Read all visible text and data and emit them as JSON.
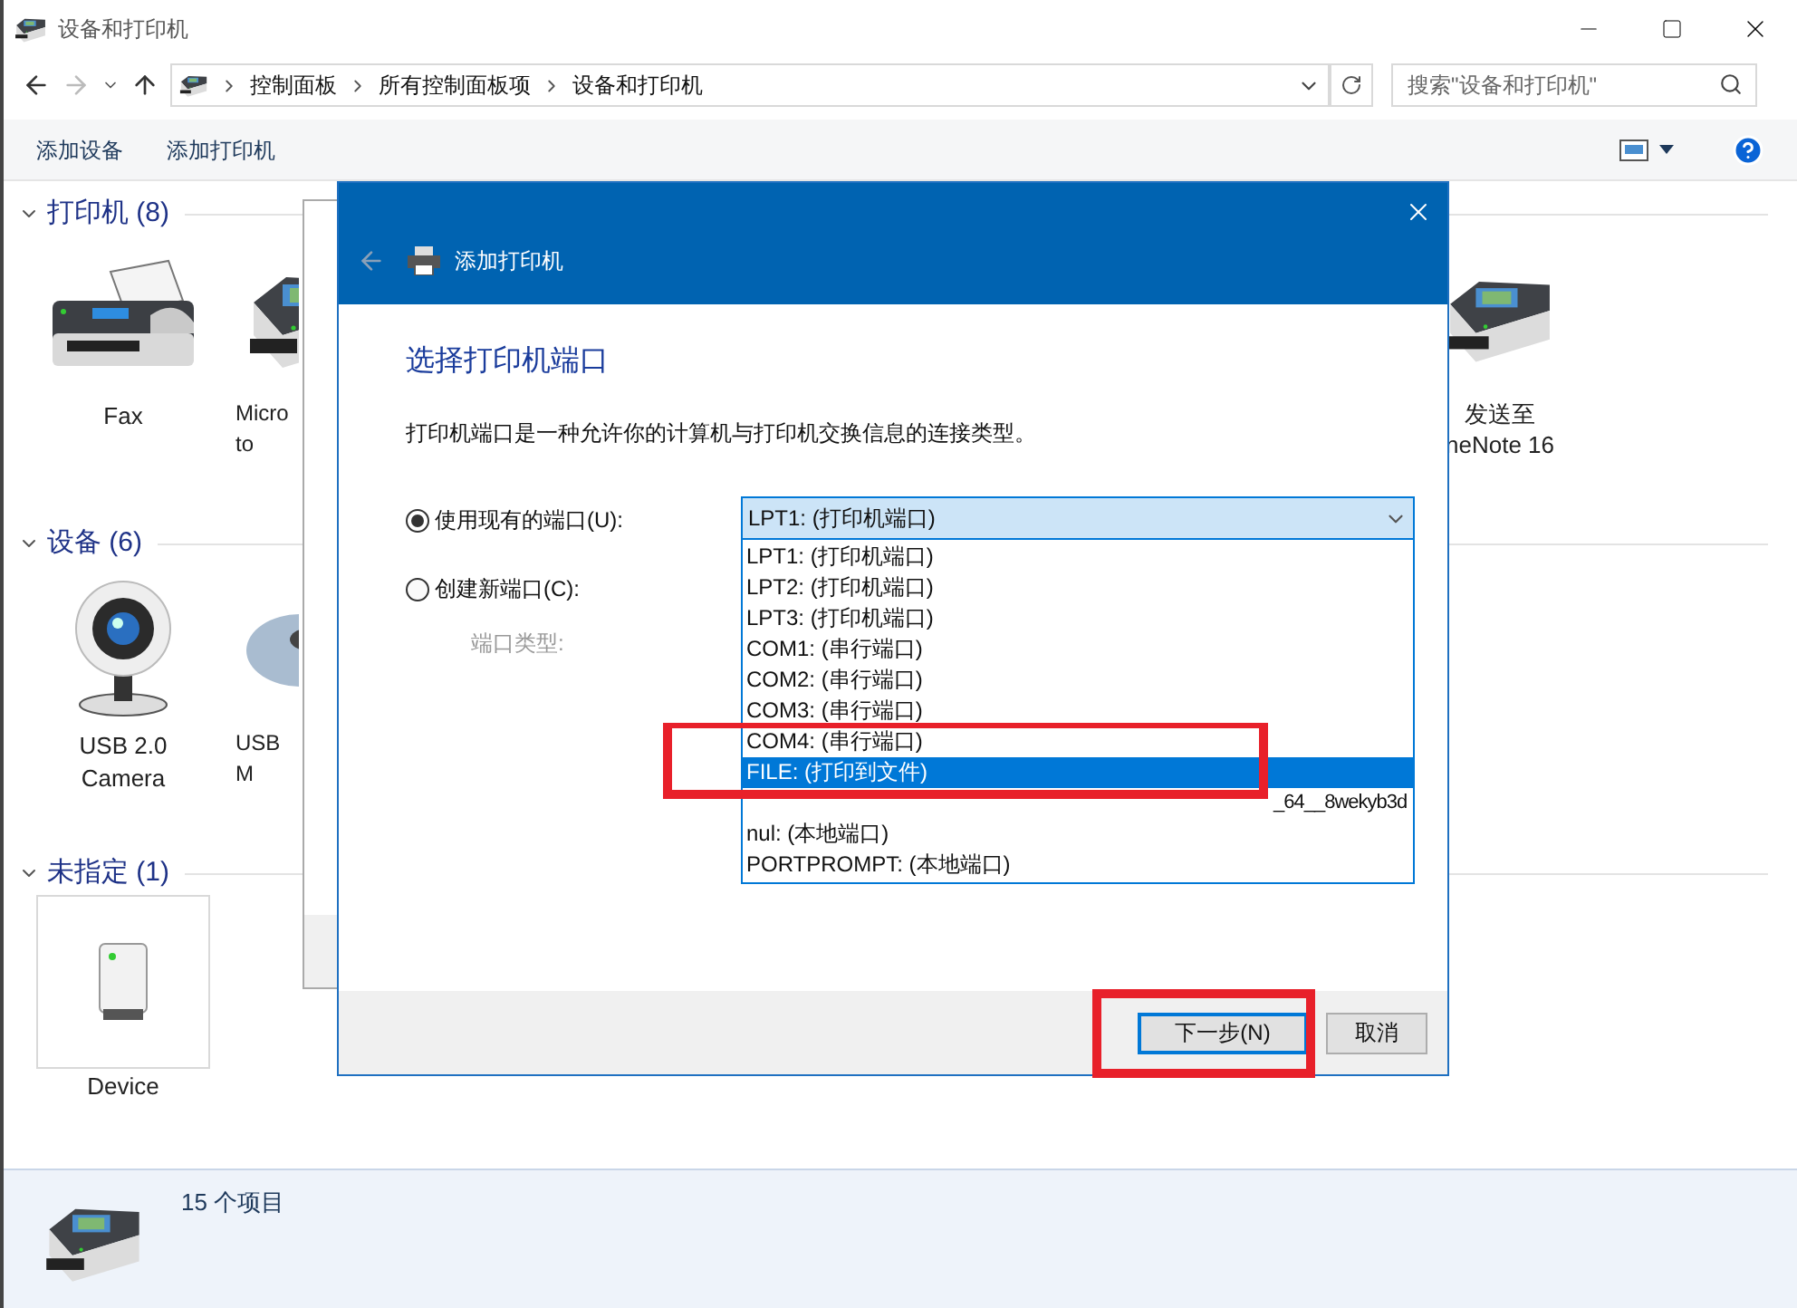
{
  "window": {
    "title": "设备和打印机"
  },
  "address": {
    "breadcrumbs": [
      "控制面板",
      "所有控制面板项",
      "设备和打印机"
    ]
  },
  "search": {
    "placeholder": "搜索\"设备和打印机\""
  },
  "toolbar": [
    "添加设备",
    "添加打印机"
  ],
  "groups": [
    {
      "title": "打印机 (8)",
      "items": [
        {
          "kind": "fax",
          "lines": [
            "Fax"
          ],
          "cut": false
        },
        {
          "kind": "printer",
          "lines": [
            "Micro",
            "to"
          ],
          "cut": true
        }
      ],
      "trailing_item": {
        "kind": "printer",
        "lines": [
          "发送至",
          "neNote 16"
        ]
      }
    },
    {
      "title": "设备 (6)",
      "items": [
        {
          "kind": "webcam",
          "lines": [
            "USB 2.0",
            "Camera"
          ],
          "cut": false
        },
        {
          "kind": "mouse",
          "lines": [
            "USB",
            "M"
          ],
          "cut": true
        }
      ]
    },
    {
      "title": "未指定 (1)",
      "items": [
        {
          "kind": "device",
          "lines": [
            "Device"
          ],
          "cut": false
        }
      ]
    }
  ],
  "status_bar": {
    "count": "15 个项目"
  },
  "dialog": {
    "title": "添加打印机",
    "heading": "选择打印机端口",
    "description": "打印机端口是一种允许你的计算机与打印机交换信息的连接类型。",
    "options": [
      {
        "label": "使用现有的端口(U):",
        "selected": true
      },
      {
        "label": "创建新端口(C):",
        "selected": false
      }
    ],
    "port_type_label": "端口类型:",
    "port_select": {
      "value": "LPT1: (打印机端口)"
    },
    "port_list": [
      {
        "kind": "text",
        "label": "LPT1: (打印机端口)",
        "selected": false
      },
      {
        "kind": "text",
        "label": "LPT2: (打印机端口)",
        "selected": false
      },
      {
        "kind": "text",
        "label": "LPT3: (打印机端口)",
        "selected": false
      },
      {
        "kind": "text",
        "label": "COM1: (串行端口)",
        "selected": false
      },
      {
        "kind": "text",
        "label": "COM2: (串行端口)",
        "selected": false
      },
      {
        "kind": "text",
        "label": "COM3: (串行端口)",
        "selected": false
      },
      {
        "kind": "text",
        "label": "COM4: (串行端口)",
        "selected": false
      },
      {
        "kind": "text",
        "label": "FILE: (打印到文件)",
        "selected": true
      },
      {
        "kind": "obscured",
        "label": "_64__8wekyb3d",
        "selected": false
      },
      {
        "kind": "text",
        "label": "nul: (本地端口)",
        "selected": false
      },
      {
        "kind": "text",
        "label": "PORTPROMPT: (本地端口)",
        "selected": false
      }
    ],
    "buttons": [
      {
        "label": "下一步(N)",
        "default": true
      },
      {
        "label": "取消",
        "default": false
      }
    ]
  }
}
